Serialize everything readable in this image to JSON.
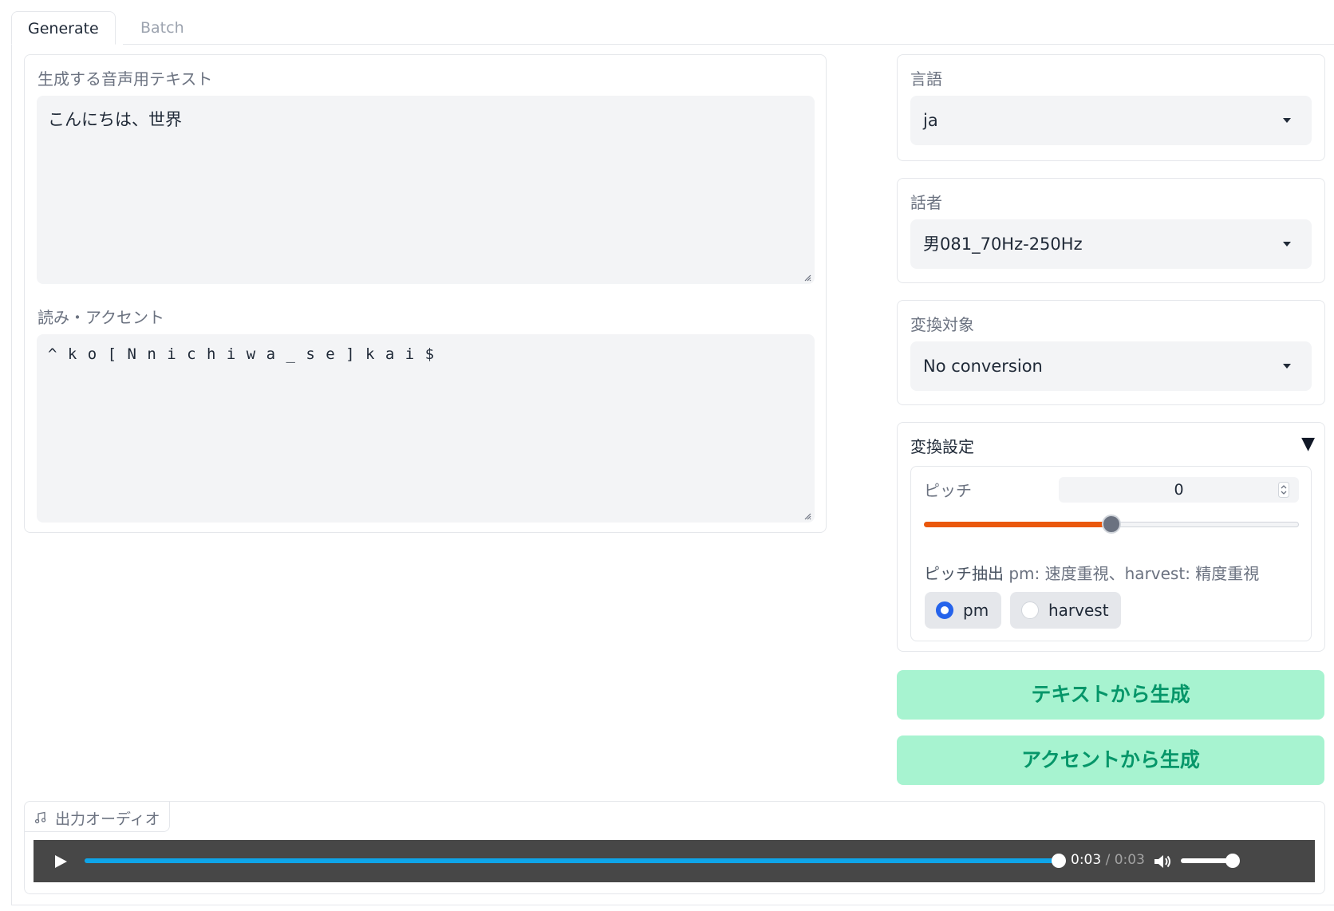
{
  "tabs": [
    {
      "label": "Generate",
      "active": true
    },
    {
      "label": "Batch",
      "active": false
    }
  ],
  "text_input": {
    "label": "生成する音声用テキスト",
    "value": "こんにちは、世界"
  },
  "accent_input": {
    "label": "読み・アクセント",
    "value": "^ k o [ N n i c h i w a _ s e ] k a i $"
  },
  "language": {
    "label": "言語",
    "selected": "ja"
  },
  "speaker": {
    "label": "話者",
    "selected": "男081_70Hz-250Hz"
  },
  "conversion_target": {
    "label": "変換対象",
    "selected": "No conversion"
  },
  "conversion_settings": {
    "label": "変換設定",
    "collapse_icon": "▼",
    "pitch": {
      "label": "ピッチ",
      "value": "0",
      "slider_fraction": 0.5
    },
    "pitch_extraction": {
      "label": "ピッチ抽出",
      "hint": "pm: 速度重視、harvest: 精度重視",
      "options": [
        "pm",
        "harvest"
      ],
      "selected": "pm"
    }
  },
  "buttons": {
    "generate_from_text": "テキストから生成",
    "generate_from_accent": "アクセントから生成"
  },
  "audio_output": {
    "label": "出力オーディオ",
    "current_time": "0:03",
    "separator": "/",
    "duration": "0:03",
    "progress": 1.0,
    "volume": 1.0
  },
  "colors": {
    "accent_orange": "#ea580c",
    "button_bg": "#a7f3d0",
    "button_text": "#059669",
    "radio_selected": "#2563eb",
    "audio_progress": "#0ea5e9"
  }
}
